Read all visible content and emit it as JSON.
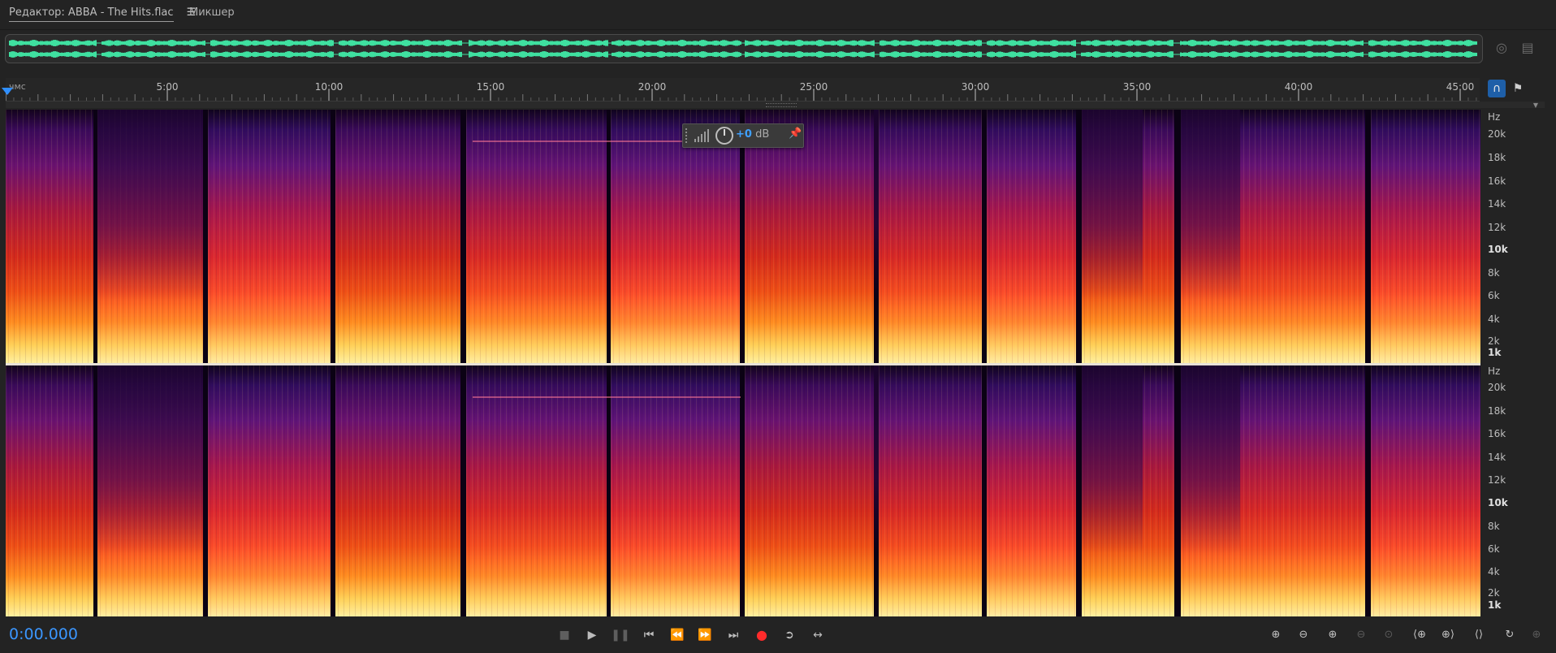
{
  "tabs": {
    "editor_label": "Редактор: ABBA - The Hits.flac",
    "mixer_label": "Микшер",
    "menu_icon": "hamburger-icon"
  },
  "ruler": {
    "unit": "чмс",
    "ticks": [
      "5:00",
      "10:00",
      "15:00",
      "20:00",
      "25:00",
      "30:00",
      "35:00",
      "40:00",
      "45:00"
    ]
  },
  "frequency_axis": {
    "unit": "Hz",
    "labels": [
      "20k",
      "18k",
      "16k",
      "14k",
      "12k",
      "10k",
      "8k",
      "6k",
      "4k",
      "2k",
      "1k"
    ],
    "bold_labels": [
      "10k",
      "1k"
    ]
  },
  "hud": {
    "gain_value": "+0",
    "gain_unit": "dB"
  },
  "transport": {
    "timecode": "0:00.000",
    "buttons": [
      "stop",
      "play",
      "pause",
      "go-to-start",
      "rewind",
      "fast-forward",
      "go-to-end",
      "record",
      "loop",
      "skip-selection"
    ]
  },
  "colors": {
    "accent_blue": "#3b96ff",
    "waveform_green": "#3fe0a0",
    "record_red": "#ff2b2b",
    "spectrum_high": "#ffe070",
    "spectrum_mid": "#e0301c",
    "spectrum_low": "#3a0a5a"
  }
}
